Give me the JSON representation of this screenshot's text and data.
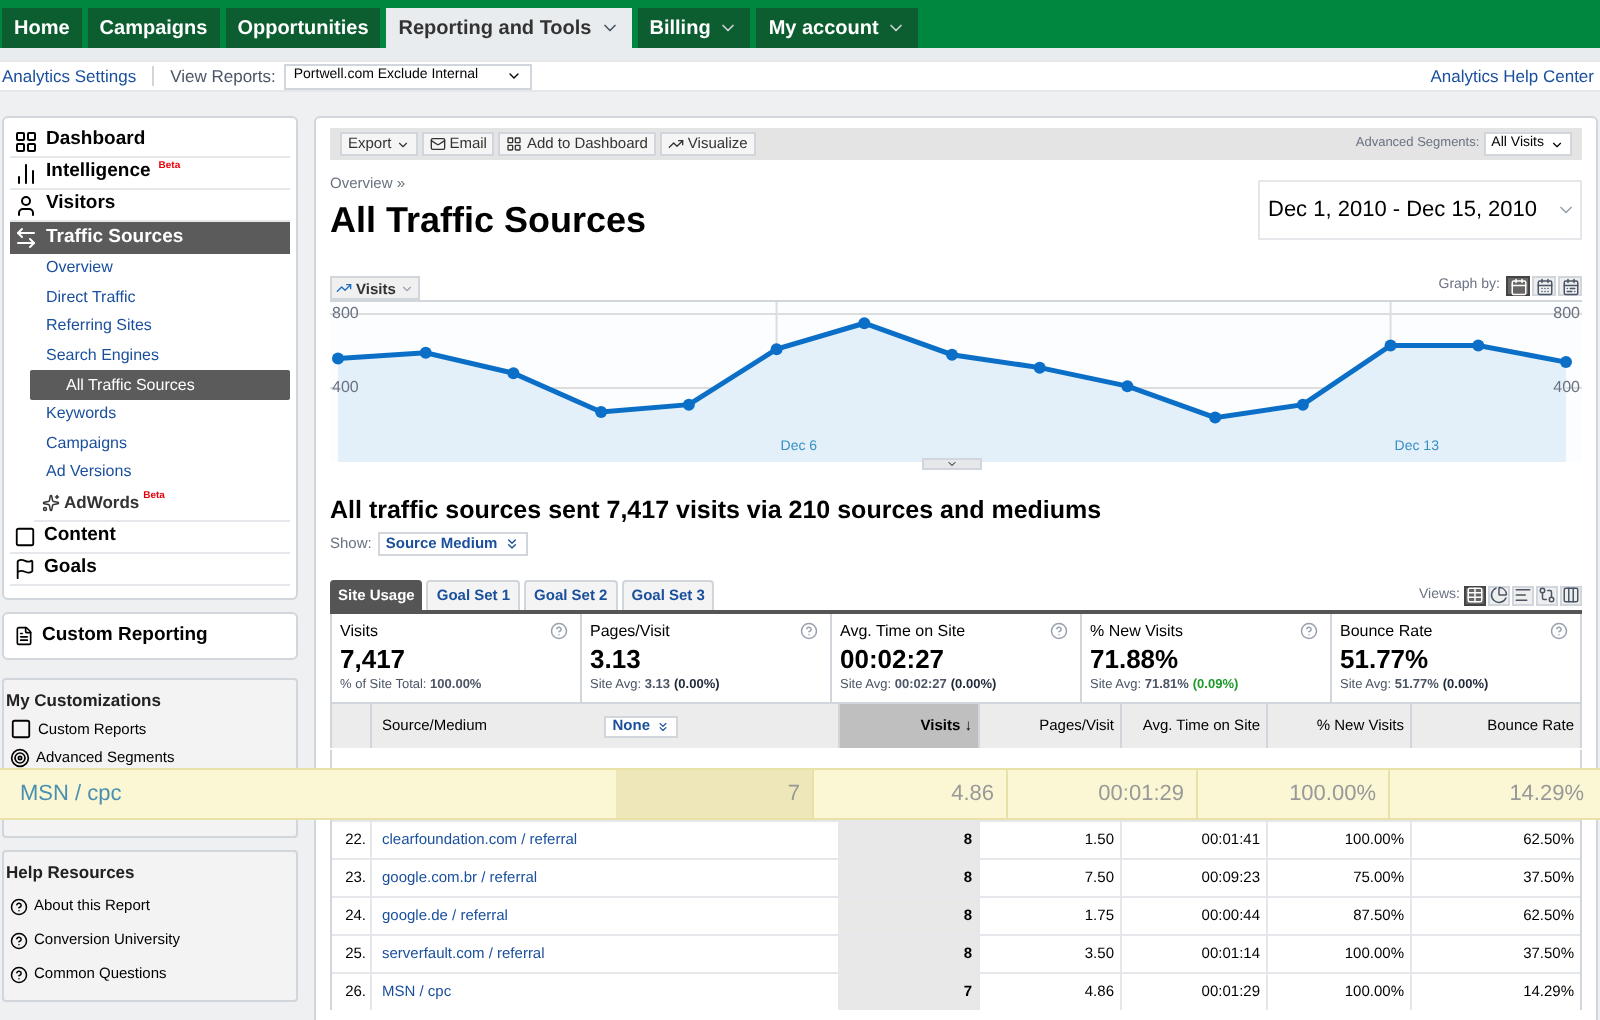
{
  "top_tabs": [
    {
      "label": "Home",
      "selected": false,
      "menu": false
    },
    {
      "label": "Campaigns",
      "selected": false,
      "menu": false
    },
    {
      "label": "Opportunities",
      "selected": false,
      "menu": false
    },
    {
      "label": "Reporting and Tools",
      "selected": true,
      "menu": true
    },
    {
      "label": "Billing",
      "selected": false,
      "menu": true
    },
    {
      "label": "My account",
      "selected": false,
      "menu": true
    }
  ],
  "sub_bar": {
    "settings_link": "Analytics Settings",
    "view_label": "View Reports:",
    "profile": "Portwell.com Exclude Internal",
    "help_link": "Analytics Help Center"
  },
  "sidebar": {
    "nav": [
      {
        "label": "Dashboard",
        "selected": false
      },
      {
        "label": "Intelligence",
        "badge": "Beta",
        "selected": false
      },
      {
        "label": "Visitors",
        "selected": false
      },
      {
        "label": "Traffic Sources",
        "selected": true,
        "children": [
          {
            "label": "Overview",
            "kind": "link",
            "selected": false
          },
          {
            "label": "Direct Traffic",
            "kind": "link",
            "selected": false
          },
          {
            "label": "Referring Sites",
            "kind": "link",
            "selected": false
          },
          {
            "label": "Search Engines",
            "kind": "link",
            "selected": false
          },
          {
            "label": "All Traffic Sources",
            "kind": "link",
            "selected": true
          },
          {
            "label": "Keywords",
            "kind": "link",
            "selected": false
          },
          {
            "label": "Campaigns",
            "kind": "link",
            "selected": false
          },
          {
            "label": "Ad Versions",
            "kind": "link",
            "selected": false
          },
          {
            "label": "AdWords",
            "kind": "product",
            "badge": "Beta",
            "selected": false
          }
        ]
      },
      {
        "label": "Content",
        "selected": false
      },
      {
        "label": "Goals",
        "selected": false
      }
    ],
    "custom_reporting": "Custom Reporting",
    "my_customizations": {
      "title": "My Customizations",
      "items": [
        {
          "label": "Custom Reports"
        },
        {
          "label": "Advanced Segments"
        }
      ]
    },
    "help_resources": {
      "title": "Help Resources",
      "items": [
        {
          "label": "About this Report"
        },
        {
          "label": "Conversion University"
        },
        {
          "label": "Common Questions"
        }
      ]
    }
  },
  "toolbar": {
    "buttons": [
      {
        "label": "Export",
        "menu": true
      },
      {
        "label": "Email",
        "menu": false
      },
      {
        "label": "Add to Dashboard",
        "menu": false
      },
      {
        "label": "Visualize",
        "menu": false
      }
    ],
    "segments_label": "Advanced Segments:",
    "segment": "All Visits"
  },
  "breadcrumb": "Overview »",
  "title": "All Traffic Sources",
  "date_range": "Dec 1, 2010 - Dec 15, 2010",
  "graph": {
    "graph_by_label": "Graph by:",
    "graph_by": [
      {
        "kind": "day",
        "selected": true
      },
      {
        "kind": "week",
        "selected": false
      },
      {
        "kind": "month",
        "selected": false
      }
    ],
    "right_axis": [
      "800",
      "400"
    ],
    "chart_data": {
      "type": "area",
      "categories": [
        null,
        null,
        null,
        null,
        null,
        "Dec 6",
        null,
        null,
        null,
        null,
        null,
        null,
        "Dec 13",
        null,
        null
      ],
      "yticks": [
        400,
        800
      ],
      "ylim": [
        0,
        800
      ],
      "series": [
        {
          "name": "Visits",
          "color": "#0b6fc7",
          "values": [
            560,
            590,
            480,
            270,
            310,
            610,
            750,
            580,
            510,
            410,
            240,
            310,
            630,
            630,
            540
          ]
        }
      ]
    }
  },
  "summary": "All traffic sources sent 7,417 visits via 210 sources and mediums",
  "show_label": "Show:",
  "show_value": "Source Medium",
  "report_tabs": [
    {
      "label": "Site Usage",
      "selected": true
    },
    {
      "label": "Goal Set 1",
      "selected": false
    },
    {
      "label": "Goal Set 2",
      "selected": false
    },
    {
      "label": "Goal Set 3",
      "selected": false
    }
  ],
  "views_label": "Views:",
  "views": [
    {
      "kind": "table",
      "selected": true
    },
    {
      "kind": "pie",
      "selected": false
    },
    {
      "kind": "bars",
      "selected": false
    },
    {
      "kind": "compare",
      "selected": false
    },
    {
      "kind": "pivot",
      "selected": false
    }
  ],
  "metrics": [
    {
      "label": "Visits",
      "value": "7,417",
      "sub": "% of Site Total: **100.00%**"
    },
    {
      "label": "Pages/Visit",
      "value": "3.13",
      "sub": "Site Avg: **3.13**",
      "delta": "(0.00%)",
      "positive": false
    },
    {
      "label": "Avg. Time on Site",
      "value": "00:02:27",
      "sub": "Site Avg: **00:02:27**",
      "delta": "(0.00%)",
      "positive": false
    },
    {
      "label": "% New Visits",
      "value": "71.88%",
      "sub": "Site Avg: **71.81%**",
      "delta": "(0.09%)",
      "positive": true
    },
    {
      "label": "Bounce Rate",
      "value": "51.77%",
      "sub": "Site Avg: **51.77%**",
      "delta": "(0.00%)",
      "positive": false
    }
  ],
  "table": {
    "columns": [
      "Source/Medium",
      "Visits ↓",
      "Pages/Visit",
      "Avg. Time on Site",
      "% New Visits",
      "Bounce Rate"
    ],
    "secondary_dimension": "None",
    "rows": [
      {
        "index": "22.",
        "source": "clearfoundation.com / referral",
        "visits": "8",
        "pages": "1.50",
        "time": "00:01:41",
        "new": "100.00%",
        "bounce": "62.50%"
      },
      {
        "index": "23.",
        "source": "google.com.br / referral",
        "visits": "8",
        "pages": "7.50",
        "time": "00:09:23",
        "new": "75.00%",
        "bounce": "37.50%"
      },
      {
        "index": "24.",
        "source": "google.de / referral",
        "visits": "8",
        "pages": "1.75",
        "time": "00:00:44",
        "new": "87.50%",
        "bounce": "62.50%"
      },
      {
        "index": "25.",
        "source": "serverfault.com / referral",
        "visits": "8",
        "pages": "3.50",
        "time": "00:01:14",
        "new": "100.00%",
        "bounce": "37.50%"
      },
      {
        "index": "26.",
        "source": "MSN / cpc",
        "visits": "7",
        "pages": "4.86",
        "time": "00:01:29",
        "new": "100.00%",
        "bounce": "14.29%"
      }
    ]
  },
  "magnified_row": {
    "source": "MSN / cpc",
    "visits": "7",
    "pages": "4.86",
    "time": "00:01:29",
    "new": "100.00%",
    "bounce": "14.29%"
  }
}
